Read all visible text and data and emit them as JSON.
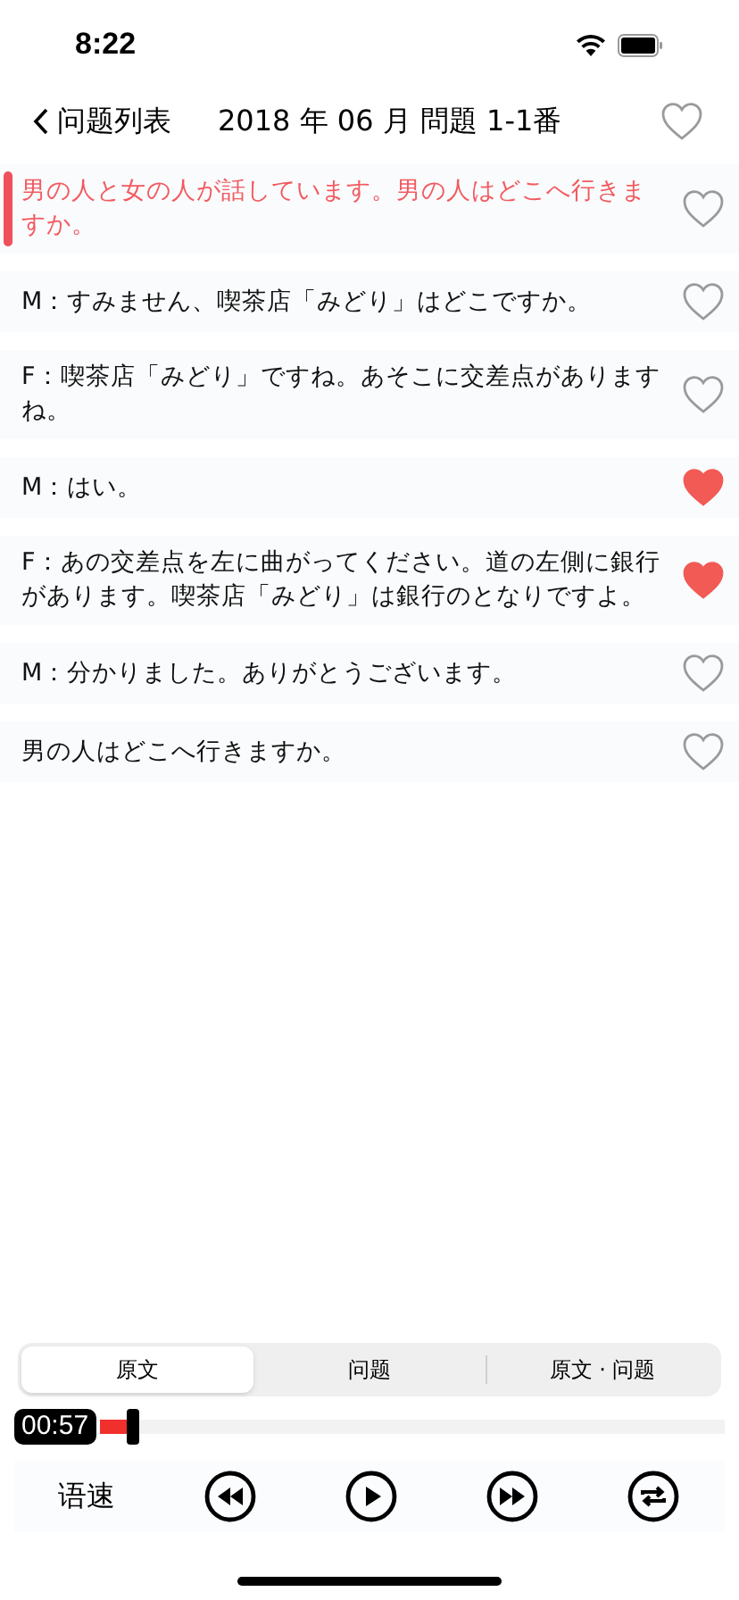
{
  "status_bar": {
    "time": "8:22"
  },
  "nav": {
    "back": "问题列表",
    "title": "2018 年 06 月 問題 1-1番",
    "favorite": false
  },
  "lines": [
    {
      "text": "男の人と女の人が話しています。男の人はどこへ行きますか。",
      "selected": true,
      "favorite": false
    },
    {
      "text": "M：すみません、喫茶店「みどり」はどこですか。",
      "selected": false,
      "favorite": false
    },
    {
      "text": "F：喫茶店「みどり」ですね。あそこに交差点がありますね。",
      "selected": false,
      "favorite": false
    },
    {
      "text": "M：はい。",
      "selected": false,
      "favorite": true
    },
    {
      "text": "F：あの交差点を左に曲がってください。道の左側に銀行があります。喫茶店「みどり」は銀行のとなりですよ。",
      "selected": false,
      "favorite": true
    },
    {
      "text": "M：分かりました。ありがとうございます。",
      "selected": false,
      "favorite": false
    },
    {
      "text": "男の人はどこへ行きますか。",
      "selected": false,
      "favorite": false
    }
  ],
  "tabs": [
    {
      "label": "原文",
      "selected": true
    },
    {
      "label": "问题",
      "selected": false
    },
    {
      "label": "原文 · 问题",
      "selected": false
    }
  ],
  "player": {
    "time": "00:57",
    "level": 0.05,
    "speed": "语速"
  }
}
